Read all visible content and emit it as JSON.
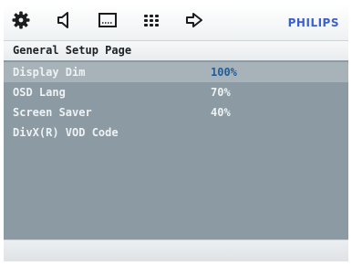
{
  "topbar": {
    "tabs": [
      {
        "icon": "gear-icon",
        "active": true
      },
      {
        "icon": "speaker-icon"
      },
      {
        "icon": "screen-icon"
      },
      {
        "icon": "grid-icon"
      },
      {
        "icon": "arrow-exit-icon"
      }
    ],
    "brand": "PHILIPS",
    "brand_color": "#3a5fd0"
  },
  "page": {
    "title": "General Setup Page"
  },
  "settings": [
    {
      "label": "Display Dim",
      "value": "100%"
    },
    {
      "label": "OSD Lang",
      "value": "70%"
    },
    {
      "label": "Screen Saver",
      "value": "40%"
    },
    {
      "label": "DivX(R) VOD Code",
      "value": ""
    }
  ],
  "colors": {
    "panel": "#8b9aa3",
    "selected_row": "#a7b2b9",
    "selected_value": "#1e5d9c"
  }
}
